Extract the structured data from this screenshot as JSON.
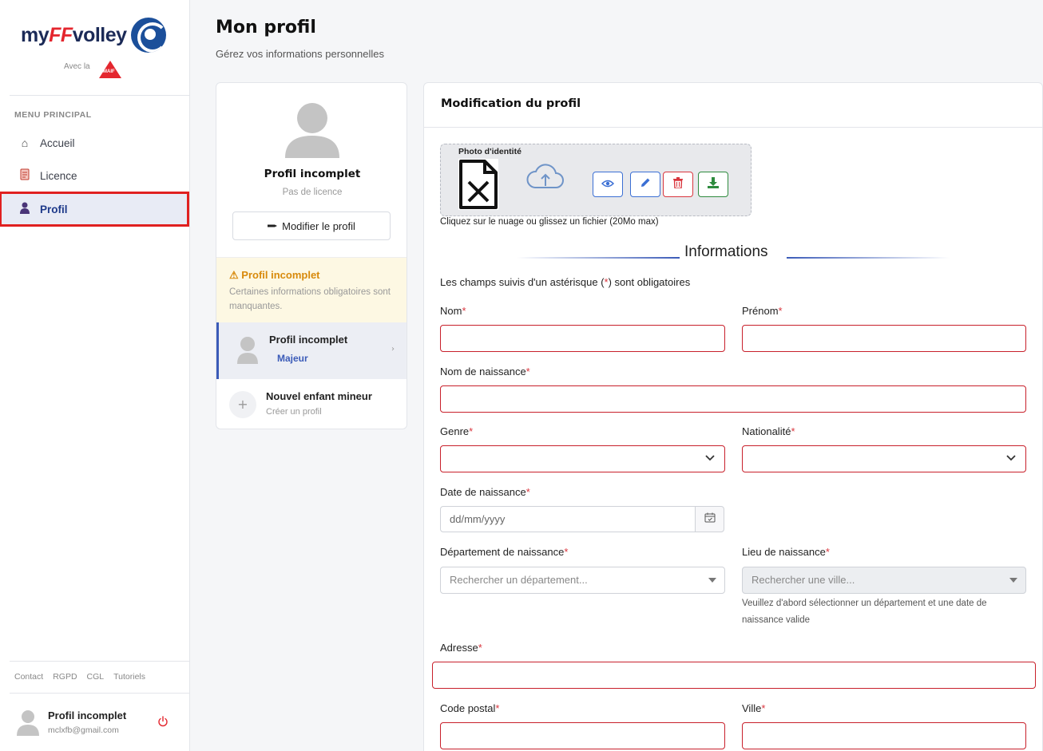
{
  "sidebar": {
    "logo": {
      "prefix": "my",
      "ff": "FF",
      "suffix": "volley",
      "avec": "Avec la",
      "partner": "MAIF"
    },
    "menu_title": "MENU PRINCIPAL",
    "items": [
      {
        "label": "Accueil",
        "icon": "home-icon"
      },
      {
        "label": "Licence",
        "icon": "license-icon"
      },
      {
        "label": "Profil",
        "icon": "user-icon",
        "active": true
      }
    ],
    "footer_links": [
      "Contact",
      "RGPD",
      "CGL",
      "Tutoriels"
    ],
    "user": {
      "name": "Profil incomplet",
      "email": "mclxfb@gmail.com"
    }
  },
  "header": {
    "title": "Mon profil",
    "subtitle": "Gérez vos informations personnelles"
  },
  "profile_card": {
    "name": "Profil incomplet",
    "license": "Pas de licence",
    "edit_button": "Modifier le profil",
    "warning": {
      "title": "Profil incomplet",
      "text": "Certaines informations obligatoires sont manquantes."
    },
    "profiles": [
      {
        "name": "Profil incomplet",
        "badge": "Majeur"
      },
      {
        "name": "Nouvel enfant mineur",
        "sub": "Créer un profil"
      }
    ]
  },
  "form": {
    "title": "Modification du profil",
    "photo": {
      "label": "Photo d'identité",
      "hint": "Cliquez sur le nuage ou glissez un fichier (20Mo max)"
    },
    "section_title": "Informations",
    "required_note_pre": "Les champs suivis d'un astérisque (",
    "required_note_star": "*",
    "required_note_post": ") sont obligatoires",
    "fields": {
      "nom": "Nom",
      "prenom": "Prénom",
      "nom_naissance": "Nom de naissance",
      "genre": "Genre",
      "nationalite": "Nationalité",
      "date_naissance": "Date de naissance",
      "date_placeholder": "dd/mm/yyyy",
      "departement": "Département de naissance",
      "departement_placeholder": "Rechercher un département...",
      "lieu": "Lieu de naissance",
      "lieu_placeholder": "Rechercher une ville...",
      "lieu_help": "Veuillez d'abord sélectionner un département et une date de naissance valide",
      "adresse": "Adresse",
      "code_postal": "Code postal",
      "ville": "Ville"
    },
    "star": "*"
  },
  "colors": {
    "accent": "#3b5bb8",
    "error": "#c8202b",
    "warning": "#d88a0c",
    "brand_red": "#e4262e",
    "brand_blue": "#1b2a57"
  }
}
